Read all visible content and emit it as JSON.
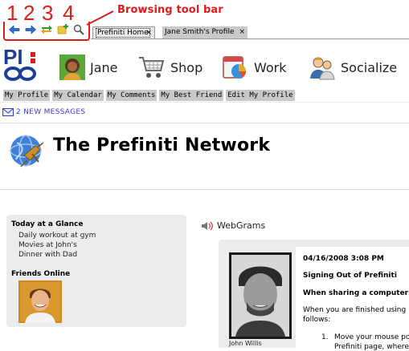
{
  "annotation": {
    "numbers": [
      "1",
      "2",
      "3",
      "4"
    ],
    "label": "Browsing tool bar",
    "color": "#e01b1b"
  },
  "toolbar": {
    "icons": [
      "back-arrow-icon",
      "forward-arrow-icon",
      "refresh-icon",
      "add-icon",
      "search-icon"
    ],
    "tabs": [
      {
        "label": "Prefiniti Home",
        "close": "×",
        "active": true
      },
      {
        "label": "Jane Smith's Profile",
        "close": "×",
        "active": false
      }
    ]
  },
  "nav": {
    "logo_text": "PI",
    "items": [
      {
        "label": "Jane",
        "icon": "avatar-icon"
      },
      {
        "label": "Shop",
        "icon": "shopping-cart-icon"
      },
      {
        "label": "Work",
        "icon": "work-chart-icon"
      },
      {
        "label": "Socialize",
        "icon": "people-icon"
      }
    ]
  },
  "subnav": [
    "My Profile",
    "My Calendar",
    "My Comments",
    "My Best Friend",
    "Edit My Profile"
  ],
  "messages": {
    "text": "2 NEW MESSAGES",
    "color": "#3a3ad0"
  },
  "banner": {
    "title": "The Prefiniti Network"
  },
  "glance": {
    "title": "Today at a Glance",
    "items": [
      "Daily workout at gym",
      "Movies at John's",
      "Dinner with Dad"
    ],
    "friends_title": "Friends Online"
  },
  "webgrams": {
    "title": "WebGrams",
    "author": "John Willis",
    "date": "04/16/2008 3:08 PM",
    "subject": "Signing Out of Prefiniti",
    "sub2": "When sharing a computer w",
    "body1": "When you are finished using",
    "body2": "follows:",
    "list_num": "1.",
    "list1": "Move your mouse po",
    "list2": "Prefiniti page, where"
  }
}
